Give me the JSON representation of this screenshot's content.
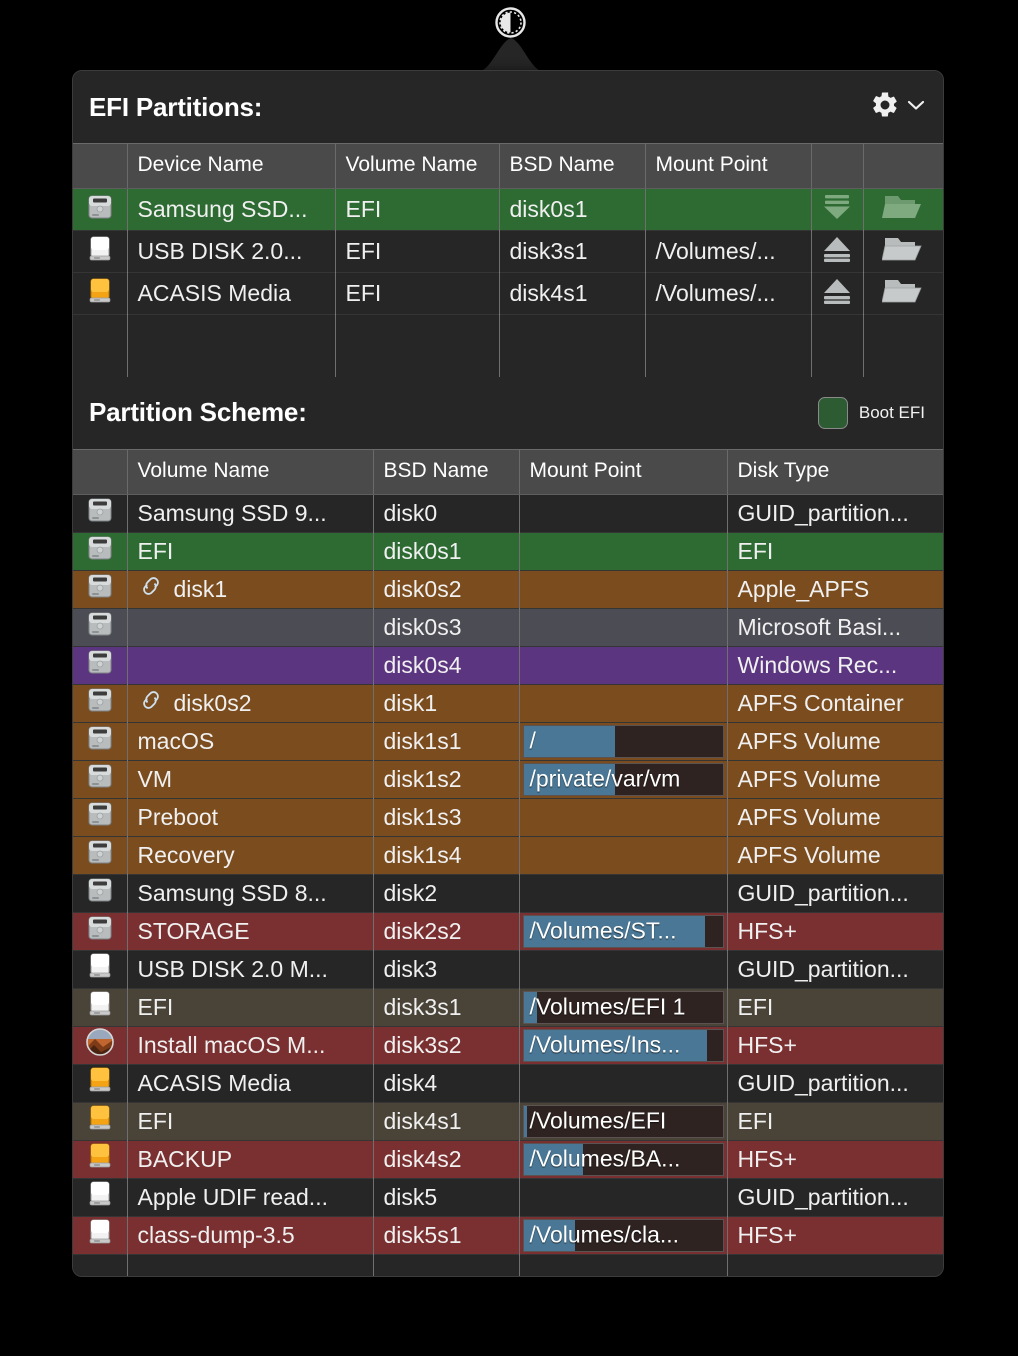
{
  "menubar": {
    "icon": "disk-pie-icon"
  },
  "efi_section": {
    "title": "EFI Partitions:",
    "gear_icon": "gear-icon",
    "chevron_icon": "chevron-down-icon",
    "columns": [
      "",
      "Device Name",
      "Volume Name",
      "BSD Name",
      "Mount Point",
      "",
      ""
    ],
    "rows": [
      {
        "icon": "internal-hdd-icon",
        "device_name": "Samsung SSD...",
        "volume_name": "EFI",
        "bsd_name": "disk0s1",
        "mount_point": "",
        "action_icon": "mount-down-triangle-icon",
        "folder_icon": "open-folder-icon",
        "selected": true
      },
      {
        "icon": "external-white-drive-icon",
        "device_name": "USB DISK 2.0...",
        "volume_name": "EFI",
        "bsd_name": "disk3s1",
        "mount_point": "/Volumes/...",
        "action_icon": "eject-icon",
        "folder_icon": "open-folder-icon",
        "selected": false
      },
      {
        "icon": "external-orange-drive-icon",
        "device_name": "ACASIS Media",
        "volume_name": "EFI",
        "bsd_name": "disk4s1",
        "mount_point": "/Volumes/...",
        "action_icon": "eject-icon",
        "folder_icon": "open-folder-icon",
        "selected": false
      }
    ]
  },
  "scheme_section": {
    "title": "Partition Scheme:",
    "boot_efi_label": "Boot EFI",
    "boot_efi_color": "#2d5c33",
    "columns": [
      "",
      "Volume Name",
      "BSD Name",
      "Mount Point",
      "Disk Type"
    ],
    "rows": [
      {
        "icon": "internal-hdd-icon",
        "volume_name": "Samsung SSD 9...",
        "bsd_name": "disk0",
        "mount_point": "",
        "mount_fill": 0,
        "disk_type": "GUID_partition...",
        "color": "bg-dark",
        "link": false
      },
      {
        "icon": "internal-hdd-icon",
        "volume_name": "EFI",
        "bsd_name": "disk0s1",
        "mount_point": "",
        "mount_fill": 0,
        "disk_type": "EFI",
        "color": "bg-green",
        "link": false
      },
      {
        "icon": "internal-hdd-icon",
        "volume_name": "disk1",
        "bsd_name": "disk0s2",
        "mount_point": "",
        "mount_fill": 0,
        "disk_type": "Apple_APFS",
        "color": "bg-brown",
        "link": true
      },
      {
        "icon": "internal-hdd-icon",
        "volume_name": "",
        "bsd_name": "disk0s3",
        "mount_point": "",
        "mount_fill": 0,
        "disk_type": "Microsoft Basi...",
        "color": "bg-grey",
        "link": false
      },
      {
        "icon": "internal-hdd-icon",
        "volume_name": "",
        "bsd_name": "disk0s4",
        "mount_point": "",
        "mount_fill": 0,
        "disk_type": "Windows Rec...",
        "color": "bg-purple",
        "link": false
      },
      {
        "icon": "internal-hdd-icon",
        "volume_name": "disk0s2",
        "bsd_name": "disk1",
        "mount_point": "",
        "mount_fill": 0,
        "disk_type": "APFS Container",
        "color": "bg-brown",
        "link": true
      },
      {
        "icon": "internal-hdd-icon",
        "volume_name": "macOS",
        "bsd_name": "disk1s1",
        "mount_point": "/",
        "mount_fill": 46,
        "disk_type": "APFS Volume",
        "color": "bg-brown",
        "link": false
      },
      {
        "icon": "internal-hdd-icon",
        "volume_name": "VM",
        "bsd_name": "disk1s2",
        "mount_point": "/private/var/vm",
        "mount_fill": 46,
        "disk_type": "APFS Volume",
        "color": "bg-brown",
        "link": false
      },
      {
        "icon": "internal-hdd-icon",
        "volume_name": "Preboot",
        "bsd_name": "disk1s3",
        "mount_point": "",
        "mount_fill": 0,
        "disk_type": "APFS Volume",
        "color": "bg-brown",
        "link": false
      },
      {
        "icon": "internal-hdd-icon",
        "volume_name": "Recovery",
        "bsd_name": "disk1s4",
        "mount_point": "",
        "mount_fill": 0,
        "disk_type": "APFS Volume",
        "color": "bg-brown",
        "link": false
      },
      {
        "icon": "internal-hdd-icon",
        "volume_name": "Samsung SSD 8...",
        "bsd_name": "disk2",
        "mount_point": "",
        "mount_fill": 0,
        "disk_type": "GUID_partition...",
        "color": "bg-dark",
        "link": false
      },
      {
        "icon": "internal-hdd-icon",
        "volume_name": "STORAGE",
        "bsd_name": "disk2s2",
        "mount_point": "/Volumes/ST...",
        "mount_fill": 91,
        "disk_type": "HFS+",
        "color": "bg-red",
        "link": false
      },
      {
        "icon": "external-white-drive-icon",
        "volume_name": "USB DISK 2.0 M...",
        "bsd_name": "disk3",
        "mount_point": "",
        "mount_fill": 0,
        "disk_type": "GUID_partition...",
        "color": "bg-dark",
        "link": false
      },
      {
        "icon": "external-white-drive-icon",
        "volume_name": "EFI",
        "bsd_name": "disk3s1",
        "mount_point": "/Volumes/EFI 1",
        "mount_fill": 7,
        "disk_type": "EFI",
        "color": "bg-olive",
        "link": false
      },
      {
        "icon": "macos-installer-icon",
        "volume_name": "Install macOS M...",
        "bsd_name": "disk3s2",
        "mount_point": "/Volumes/Ins...",
        "mount_fill": 92,
        "disk_type": "HFS+",
        "color": "bg-red",
        "link": false
      },
      {
        "icon": "external-orange-drive-icon",
        "volume_name": "ACASIS Media",
        "bsd_name": "disk4",
        "mount_point": "",
        "mount_fill": 0,
        "disk_type": "GUID_partition...",
        "color": "bg-dark",
        "link": false
      },
      {
        "icon": "external-orange-drive-icon",
        "volume_name": "EFI",
        "bsd_name": "disk4s1",
        "mount_point": "/Volumes/EFI",
        "mount_fill": 2,
        "disk_type": "EFI",
        "color": "bg-olive",
        "link": false
      },
      {
        "icon": "external-orange-drive-icon",
        "volume_name": "BACKUP",
        "bsd_name": "disk4s2",
        "mount_point": "/Volumes/BA...",
        "mount_fill": 30,
        "disk_type": "HFS+",
        "color": "bg-red",
        "link": false
      },
      {
        "icon": "external-white-drive-icon",
        "volume_name": "Apple UDIF read...",
        "bsd_name": "disk5",
        "mount_point": "",
        "mount_fill": 0,
        "disk_type": "GUID_partition...",
        "color": "bg-dark",
        "link": false
      },
      {
        "icon": "external-white-drive-icon",
        "volume_name": "class-dump-3.5",
        "bsd_name": "disk5s1",
        "mount_point": "/Volumes/cla...",
        "mount_fill": 26,
        "disk_type": "HFS+",
        "color": "bg-red",
        "link": false
      }
    ]
  }
}
